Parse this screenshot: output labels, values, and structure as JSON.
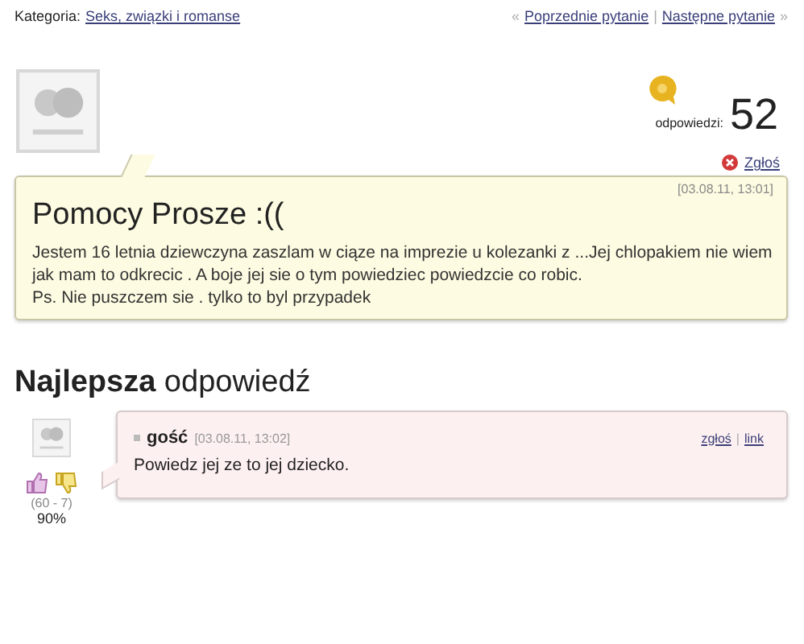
{
  "category": {
    "label": "Kategoria:",
    "link": "Seks, związki i romanse"
  },
  "nav": {
    "prev_mark": "«",
    "prev": "Poprzednie pytanie",
    "separator": "|",
    "next": "Następne pytanie",
    "next_mark": "»"
  },
  "answers_count": {
    "label": "odpowiedzi:",
    "value": "52"
  },
  "report": "Zgłoś",
  "question": {
    "date": "[03.08.11, 13:01]",
    "title": "Pomocy Prosze :((",
    "body": [
      "Jestem 16 letnia dziewczyna zaszlam w ciąze na imprezie u kolezanki z ...Jej chlopakiem nie wiem jak mam to odkrecic . A boje jej sie o tym powiedziec powiedzcie co robic.",
      "Ps. Nie puszczem sie . tylko to byl przypadek"
    ]
  },
  "best_answer": {
    "heading": "**Najlepsza** odpowiedź",
    "author": "gość",
    "date": "[03.08.11, 13:02]",
    "report": "zgłoś",
    "separator": "|",
    "link": "link",
    "text": "Powiedz jej ze to jej dziecko.",
    "votes": "(60 - 7)",
    "percent": "90%"
  }
}
